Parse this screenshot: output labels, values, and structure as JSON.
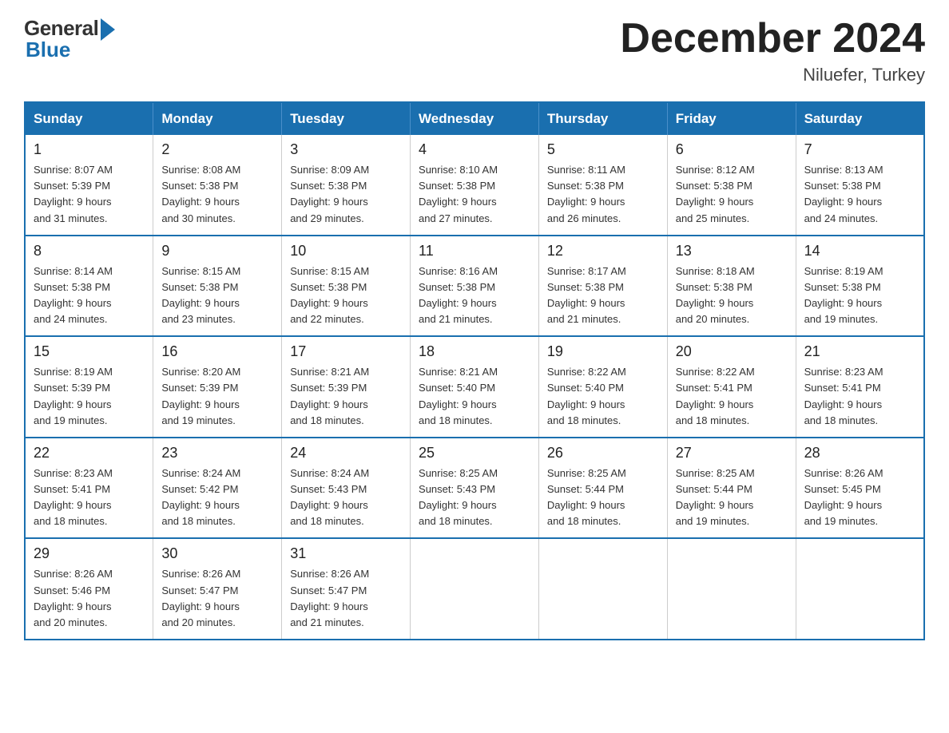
{
  "header": {
    "logo_general": "General",
    "logo_blue": "Blue",
    "month_title": "December 2024",
    "location": "Niluefer, Turkey"
  },
  "days_of_week": [
    "Sunday",
    "Monday",
    "Tuesday",
    "Wednesday",
    "Thursday",
    "Friday",
    "Saturday"
  ],
  "weeks": [
    [
      {
        "day": "1",
        "info": "Sunrise: 8:07 AM\nSunset: 5:39 PM\nDaylight: 9 hours\nand 31 minutes."
      },
      {
        "day": "2",
        "info": "Sunrise: 8:08 AM\nSunset: 5:38 PM\nDaylight: 9 hours\nand 30 minutes."
      },
      {
        "day": "3",
        "info": "Sunrise: 8:09 AM\nSunset: 5:38 PM\nDaylight: 9 hours\nand 29 minutes."
      },
      {
        "day": "4",
        "info": "Sunrise: 8:10 AM\nSunset: 5:38 PM\nDaylight: 9 hours\nand 27 minutes."
      },
      {
        "day": "5",
        "info": "Sunrise: 8:11 AM\nSunset: 5:38 PM\nDaylight: 9 hours\nand 26 minutes."
      },
      {
        "day": "6",
        "info": "Sunrise: 8:12 AM\nSunset: 5:38 PM\nDaylight: 9 hours\nand 25 minutes."
      },
      {
        "day": "7",
        "info": "Sunrise: 8:13 AM\nSunset: 5:38 PM\nDaylight: 9 hours\nand 24 minutes."
      }
    ],
    [
      {
        "day": "8",
        "info": "Sunrise: 8:14 AM\nSunset: 5:38 PM\nDaylight: 9 hours\nand 24 minutes."
      },
      {
        "day": "9",
        "info": "Sunrise: 8:15 AM\nSunset: 5:38 PM\nDaylight: 9 hours\nand 23 minutes."
      },
      {
        "day": "10",
        "info": "Sunrise: 8:15 AM\nSunset: 5:38 PM\nDaylight: 9 hours\nand 22 minutes."
      },
      {
        "day": "11",
        "info": "Sunrise: 8:16 AM\nSunset: 5:38 PM\nDaylight: 9 hours\nand 21 minutes."
      },
      {
        "day": "12",
        "info": "Sunrise: 8:17 AM\nSunset: 5:38 PM\nDaylight: 9 hours\nand 21 minutes."
      },
      {
        "day": "13",
        "info": "Sunrise: 8:18 AM\nSunset: 5:38 PM\nDaylight: 9 hours\nand 20 minutes."
      },
      {
        "day": "14",
        "info": "Sunrise: 8:19 AM\nSunset: 5:38 PM\nDaylight: 9 hours\nand 19 minutes."
      }
    ],
    [
      {
        "day": "15",
        "info": "Sunrise: 8:19 AM\nSunset: 5:39 PM\nDaylight: 9 hours\nand 19 minutes."
      },
      {
        "day": "16",
        "info": "Sunrise: 8:20 AM\nSunset: 5:39 PM\nDaylight: 9 hours\nand 19 minutes."
      },
      {
        "day": "17",
        "info": "Sunrise: 8:21 AM\nSunset: 5:39 PM\nDaylight: 9 hours\nand 18 minutes."
      },
      {
        "day": "18",
        "info": "Sunrise: 8:21 AM\nSunset: 5:40 PM\nDaylight: 9 hours\nand 18 minutes."
      },
      {
        "day": "19",
        "info": "Sunrise: 8:22 AM\nSunset: 5:40 PM\nDaylight: 9 hours\nand 18 minutes."
      },
      {
        "day": "20",
        "info": "Sunrise: 8:22 AM\nSunset: 5:41 PM\nDaylight: 9 hours\nand 18 minutes."
      },
      {
        "day": "21",
        "info": "Sunrise: 8:23 AM\nSunset: 5:41 PM\nDaylight: 9 hours\nand 18 minutes."
      }
    ],
    [
      {
        "day": "22",
        "info": "Sunrise: 8:23 AM\nSunset: 5:41 PM\nDaylight: 9 hours\nand 18 minutes."
      },
      {
        "day": "23",
        "info": "Sunrise: 8:24 AM\nSunset: 5:42 PM\nDaylight: 9 hours\nand 18 minutes."
      },
      {
        "day": "24",
        "info": "Sunrise: 8:24 AM\nSunset: 5:43 PM\nDaylight: 9 hours\nand 18 minutes."
      },
      {
        "day": "25",
        "info": "Sunrise: 8:25 AM\nSunset: 5:43 PM\nDaylight: 9 hours\nand 18 minutes."
      },
      {
        "day": "26",
        "info": "Sunrise: 8:25 AM\nSunset: 5:44 PM\nDaylight: 9 hours\nand 18 minutes."
      },
      {
        "day": "27",
        "info": "Sunrise: 8:25 AM\nSunset: 5:44 PM\nDaylight: 9 hours\nand 19 minutes."
      },
      {
        "day": "28",
        "info": "Sunrise: 8:26 AM\nSunset: 5:45 PM\nDaylight: 9 hours\nand 19 minutes."
      }
    ],
    [
      {
        "day": "29",
        "info": "Sunrise: 8:26 AM\nSunset: 5:46 PM\nDaylight: 9 hours\nand 20 minutes."
      },
      {
        "day": "30",
        "info": "Sunrise: 8:26 AM\nSunset: 5:47 PM\nDaylight: 9 hours\nand 20 minutes."
      },
      {
        "day": "31",
        "info": "Sunrise: 8:26 AM\nSunset: 5:47 PM\nDaylight: 9 hours\nand 21 minutes."
      },
      {
        "day": "",
        "info": ""
      },
      {
        "day": "",
        "info": ""
      },
      {
        "day": "",
        "info": ""
      },
      {
        "day": "",
        "info": ""
      }
    ]
  ]
}
